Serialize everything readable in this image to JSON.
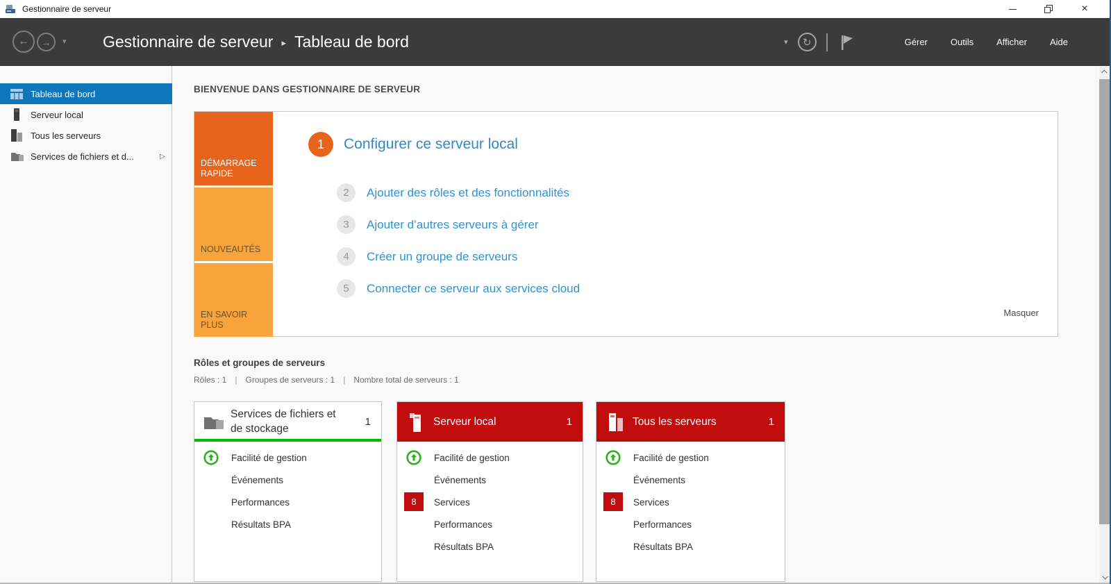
{
  "window": {
    "title": "Gestionnaire de serveur"
  },
  "icons": {
    "back": "←",
    "forward": "→",
    "nav_caret": "▾",
    "dropdown_caret": "▾",
    "refresh": "↻",
    "breadcrumb_sep": "▸",
    "expand_arrow": "▷",
    "close": "×"
  },
  "header": {
    "breadcrumb_root": "Gestionnaire de serveur",
    "breadcrumb_current": "Tableau de bord",
    "menu": {
      "manage": "Gérer",
      "tools": "Outils",
      "view": "Afficher",
      "help": "Aide"
    }
  },
  "sidebar": {
    "items": [
      {
        "label": "Tableau de bord",
        "selected": true
      },
      {
        "label": "Serveur local",
        "selected": false
      },
      {
        "label": "Tous les serveurs",
        "selected": false
      },
      {
        "label": "Services de fichiers et d...",
        "selected": false,
        "expandable": true
      }
    ]
  },
  "main": {
    "welcome_heading": "BIENVENUE DANS GESTIONNAIRE DE SERVEUR",
    "quickstart": {
      "sections": [
        {
          "label": "DÉMARRAGE RAPIDE"
        },
        {
          "label": "NOUVEAUTÉS"
        },
        {
          "label": "EN SAVOIR PLUS"
        }
      ],
      "steps": [
        {
          "num": "1",
          "label": "Configurer ce serveur local"
        },
        {
          "num": "2",
          "label": "Ajouter des rôles et des fonctionnalités"
        },
        {
          "num": "3",
          "label": "Ajouter d’autres serveurs à gérer"
        },
        {
          "num": "4",
          "label": "Créer un groupe de serveurs"
        },
        {
          "num": "5",
          "label": "Connecter ce serveur aux services cloud"
        }
      ],
      "hide_label": "Masquer"
    },
    "roles_section": {
      "title": "Rôles et groupes de serveurs",
      "stat_roles": "Rôles : 1",
      "stat_groups": "Groupes de serveurs : 1",
      "stat_total": "Nombre total de serveurs : 1",
      "stat_sep": "|"
    },
    "cards": [
      {
        "title": "Services de fichiers et de stockage",
        "title_line1": "Services de fichiers et",
        "title_line2": "de stockage",
        "count": "1",
        "items": [
          {
            "label": "Facilité de gestion"
          },
          {
            "label": "Événements"
          },
          {
            "label": "Performances"
          },
          {
            "label": "Résultats BPA"
          }
        ]
      },
      {
        "title": "Serveur local",
        "count": "1",
        "items": [
          {
            "label": "Facilité de gestion"
          },
          {
            "label": "Événements"
          },
          {
            "label": "Services",
            "badge": "8"
          },
          {
            "label": "Performances"
          },
          {
            "label": "Résultats BPA"
          }
        ]
      },
      {
        "title": "Tous les serveurs",
        "count": "1",
        "items": [
          {
            "label": "Facilité de gestion"
          },
          {
            "label": "Événements"
          },
          {
            "label": "Services",
            "badge": "8"
          },
          {
            "label": "Performances"
          },
          {
            "label": "Résultats BPA"
          }
        ]
      }
    ]
  },
  "colors": {
    "accent_blue_selected": "#1076BC",
    "command_bar_dark": "#3B3B3B",
    "quickstart_orange": "#E8641C",
    "section_orange_light": "#F8A33C",
    "card_header_red": "#C00C0C",
    "status_green": "#00B800",
    "link_blue": "#3092CE"
  }
}
